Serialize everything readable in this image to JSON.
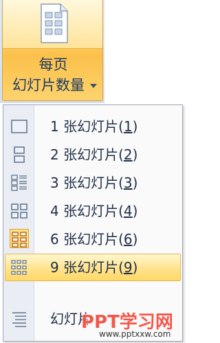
{
  "ribbon_button": {
    "label_line1": "每页",
    "label_line2": "幻灯片数量",
    "icon": "slides-per-page-icon"
  },
  "menu": {
    "items": [
      {
        "number": "1",
        "text": "张幻灯片(",
        "key": "1",
        "close": ")",
        "icon": "one-slide-icon"
      },
      {
        "number": "2",
        "text": "张幻灯片(",
        "key": "2",
        "close": ")",
        "icon": "two-slides-icon"
      },
      {
        "number": "3",
        "text": "张幻灯片(",
        "key": "3",
        "close": ")",
        "icon": "three-slides-icon"
      },
      {
        "number": "4",
        "text": "张幻灯片(",
        "key": "4",
        "close": ")",
        "icon": "four-slides-icon"
      },
      {
        "number": "6",
        "text": "张幻灯片(",
        "key": "6",
        "close": ")",
        "icon": "six-slides-icon",
        "selected": true
      },
      {
        "number": "9",
        "text": "张幻灯片(",
        "key": "9",
        "close": ")",
        "icon": "nine-slides-icon",
        "highlighted": true
      },
      {
        "number": "",
        "text": "幻灯片",
        "key": "",
        "close": "",
        "icon": "outline-icon"
      }
    ]
  },
  "watermark": {
    "title": "PPT学习网",
    "url": "www.pptxxw.com"
  },
  "colors": {
    "highlight": "#ffe38e",
    "accent_text": "#1f3b63",
    "watermark": "#f2584a"
  }
}
